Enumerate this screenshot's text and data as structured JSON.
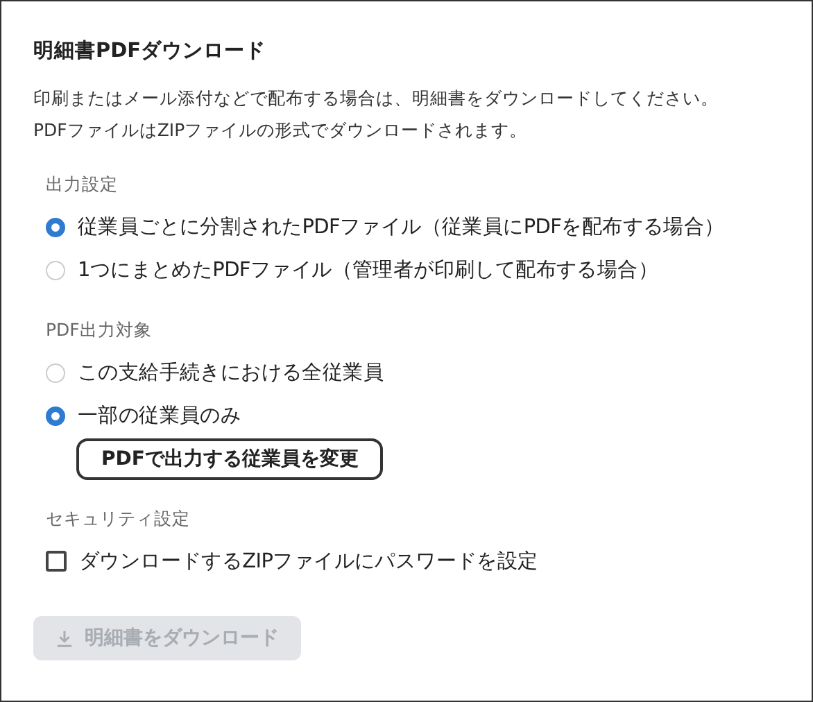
{
  "title": "明細書PDFダウンロード",
  "description": [
    "印刷またはメール添付などで配布する場合は、明細書をダウンロードしてください。",
    "PDFファイルはZIPファイルの形式でダウンロードされます。"
  ],
  "sections": [
    {
      "kind": "radio",
      "label": "出力設定",
      "options": [
        {
          "label": "従業員ごとに分割されたPDFファイル（従業員にPDFを配布する場合）",
          "selected": true
        },
        {
          "label": "1つにまとめたPDFファイル（管理者が印刷して配布する場合）",
          "selected": false
        }
      ]
    },
    {
      "kind": "radio",
      "label": "PDF出力対象",
      "options": [
        {
          "label": "この支給手続きにおける全従業員",
          "selected": false
        },
        {
          "label": "一部の従業員のみ",
          "selected": true,
          "button": "PDFで出力する従業員を変更"
        }
      ]
    },
    {
      "kind": "checkbox",
      "label": "セキュリティ設定",
      "options": [
        {
          "label": "ダウンロードするZIPファイルにパスワードを設定",
          "checked": false
        }
      ]
    }
  ],
  "download_button": {
    "label": "明細書をダウンロード",
    "disabled": true
  }
}
